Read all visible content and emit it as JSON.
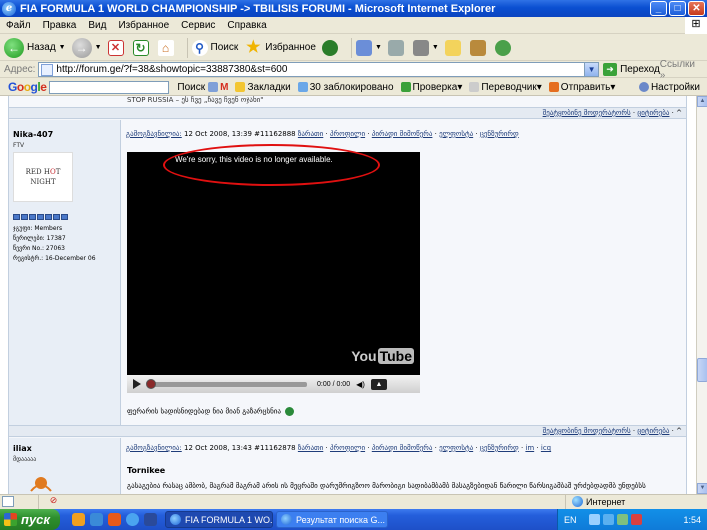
{
  "window": {
    "title": "FIA FORMULA 1 WORLD CHAMPIONSHIP -> TBILISIS FORUMI - Microsoft Internet Explorer",
    "controls": {
      "minimize": "_",
      "maximize": "□",
      "close": "✕"
    }
  },
  "menu": [
    "Файл",
    "Правка",
    "Вид",
    "Избранное",
    "Сервис",
    "Справка"
  ],
  "toolbar": {
    "back_label": "Назад",
    "search_label": "Поиск",
    "favorites_label": "Избранное"
  },
  "address": {
    "label": "Адрес:",
    "url": "http://forum.ge/?f=38&showtopic=33887380&st=600",
    "go_label": "Переход",
    "links_label": "Ссылки"
  },
  "google_toolbar": {
    "logo": [
      "G",
      "o",
      "o",
      "g",
      "l",
      "e"
    ],
    "items": [
      "Поиск",
      "Закладки",
      "30 заблокировано",
      "Проверка",
      "Переводчик",
      "Отправить",
      "Настройки"
    ]
  },
  "page": {
    "top_text": "STOP RUSSIA – ეს ჩვე „ჩავე ჩვენ ოჯახი\"",
    "row1_links": [
      "შეატყობინე მოდერატორს",
      "ციტირება"
    ],
    "post1": {
      "user_name": "Nika-407",
      "user_title": "FTV",
      "avatar_line1": "RED H",
      "avatar_hot": "O",
      "avatar_line1_end": "T",
      "avatar_line2": "NIGHT",
      "group": "ჯგუფი: Members",
      "posts": "წერილები: 17387",
      "member_no": "წევრი No.: 27063",
      "registered": "რეგისტრ.: 16-December 06",
      "header_prefix": "გამოგზავნილია:",
      "header_date": "12 Oct 2008, 13:39",
      "header_id": "#11162888",
      "header_links": [
        "ზარათი",
        "პროფილი",
        "პირადი მიმოწერა",
        "ელფოსტა",
        "ცენზურირდ"
      ],
      "video_message": "We're sorry, this video is no longer available.",
      "video_time": "0:00 / 0:00",
      "yt_you": "You",
      "yt_tube": "Tube",
      "caption": "ფერარის სადისნიდებად ნია მიან გაზარცსნია"
    },
    "row2_links": [
      "შეატყობინე მოდერატორს",
      "ციტირება"
    ],
    "post2": {
      "user_name": "iliax",
      "user_title": "მდააააა",
      "header_prefix": "გამოგზავნილია:",
      "header_date": "12 Oct 2008, 13:43",
      "header_id": "#11162878",
      "header_links": [
        "ზარათი",
        "პროფილი",
        "პირადი მიმოწერა",
        "ელფოსტა",
        "ცენზურირდ",
        "im",
        "icq"
      ],
      "title": "Tornikee",
      "body": "გასაგებია რასაც ამბობ, მაგრამ მაგრამ არის ის მეცრაში დარუმრიგზოო მარობიგი სადიბამბამბ მასაგზებიდან წარილი წარსიგამბაშ ურძებდადმბ უნდებსს"
    }
  },
  "status": {
    "zone": "Интернет"
  },
  "taskbar": {
    "start": "пуск",
    "tasks": [
      "FIA FORMULA 1 WO...",
      "Результат поиска G..."
    ],
    "lang": "EN",
    "time": "1:54"
  },
  "colors": {
    "highlight_circle": "#e01010",
    "forum_link": "#1f3d7a",
    "xp_blue": "#0a4fd1"
  }
}
